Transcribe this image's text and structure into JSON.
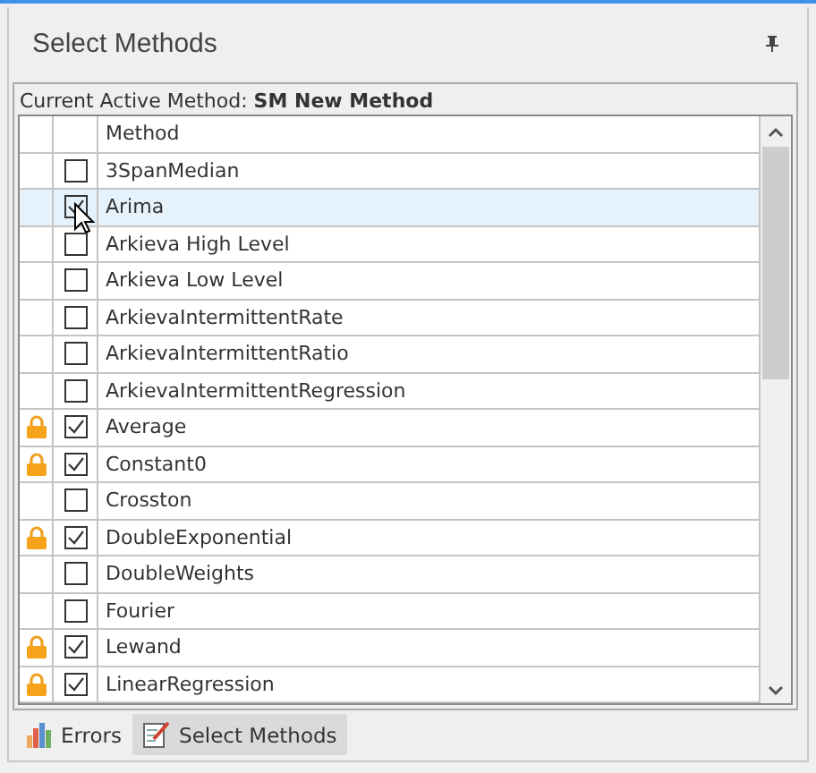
{
  "panel": {
    "title": "Select Methods"
  },
  "active_method": {
    "label": "Current Active Method:",
    "value": "SM New Method"
  },
  "table": {
    "columns": [
      "Method"
    ],
    "rows": [
      {
        "name": "3SpanMedian",
        "checked": false,
        "locked": false,
        "highlighted": false
      },
      {
        "name": "Arima",
        "checked": true,
        "locked": false,
        "highlighted": true
      },
      {
        "name": "Arkieva High Level",
        "checked": false,
        "locked": false,
        "highlighted": false
      },
      {
        "name": "Arkieva Low Level",
        "checked": false,
        "locked": false,
        "highlighted": false
      },
      {
        "name": "ArkievaIntermittentRate",
        "checked": false,
        "locked": false,
        "highlighted": false
      },
      {
        "name": "ArkievaIntermittentRatio",
        "checked": false,
        "locked": false,
        "highlighted": false
      },
      {
        "name": "ArkievaIntermittentRegression",
        "checked": false,
        "locked": false,
        "highlighted": false
      },
      {
        "name": "Average",
        "checked": true,
        "locked": true,
        "highlighted": false
      },
      {
        "name": "Constant0",
        "checked": true,
        "locked": true,
        "highlighted": false
      },
      {
        "name": "Crosston",
        "checked": false,
        "locked": false,
        "highlighted": false
      },
      {
        "name": "DoubleExponential",
        "checked": true,
        "locked": true,
        "highlighted": false
      },
      {
        "name": "DoubleWeights",
        "checked": false,
        "locked": false,
        "highlighted": false
      },
      {
        "name": "Fourier",
        "checked": false,
        "locked": false,
        "highlighted": false
      },
      {
        "name": "Lewand",
        "checked": true,
        "locked": true,
        "highlighted": false
      },
      {
        "name": "LinearRegression",
        "checked": true,
        "locked": true,
        "highlighted": false
      }
    ]
  },
  "tabs": [
    {
      "label": "Errors",
      "selected": false,
      "kind": "chart"
    },
    {
      "label": "Select Methods",
      "selected": true,
      "kind": "checklist"
    }
  ]
}
